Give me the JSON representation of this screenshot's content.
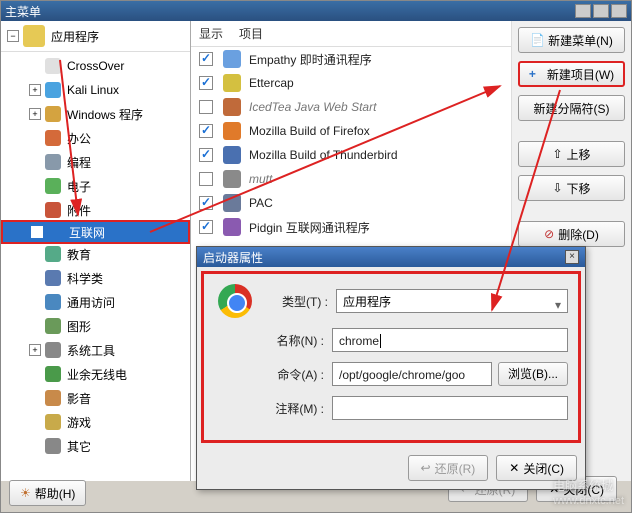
{
  "window": {
    "title": "主菜单"
  },
  "left": {
    "header": "应用程序",
    "items": [
      {
        "label": "CrossOver",
        "color": "#e0e0e0"
      },
      {
        "label": "Kali Linux",
        "color": "#4aa3e0"
      },
      {
        "label": "Windows 程序",
        "color": "#d4a340"
      },
      {
        "label": "办公",
        "color": "#d46a3a"
      },
      {
        "label": "编程",
        "color": "#8899aa"
      },
      {
        "label": "电子",
        "color": "#5ab05a"
      },
      {
        "label": "附件",
        "color": "#c8543a"
      },
      {
        "label": "互联网",
        "color": "#2a72c8",
        "selected": true
      },
      {
        "label": "教育",
        "color": "#55aa88"
      },
      {
        "label": "科学类",
        "color": "#5a7ab0"
      },
      {
        "label": "通用访问",
        "color": "#4a88c0"
      },
      {
        "label": "图形",
        "color": "#6a9a5a"
      },
      {
        "label": "系统工具",
        "color": "#888888"
      },
      {
        "label": "业余无线电",
        "color": "#4a9a4a"
      },
      {
        "label": "影音",
        "color": "#c88a4a"
      },
      {
        "label": "游戏",
        "color": "#c8aa4a"
      },
      {
        "label": "其它",
        "color": "#888888"
      }
    ]
  },
  "mid": {
    "col_show": "显示",
    "col_item": "项目",
    "items": [
      {
        "label": "Empathy 即时通讯程序",
        "checked": true,
        "color": "#6aa0e0"
      },
      {
        "label": "Ettercap",
        "checked": true,
        "color": "#d4c040"
      },
      {
        "label": "IcedTea Java Web Start",
        "checked": false,
        "color": "#c06a3a",
        "italic": true
      },
      {
        "label": "Mozilla Build of Firefox",
        "checked": true,
        "color": "#e07a2a"
      },
      {
        "label": "Mozilla Build of Thunderbird",
        "checked": true,
        "color": "#4a70b0"
      },
      {
        "label": "mutt",
        "checked": false,
        "color": "#8a8a8a",
        "italic": true
      },
      {
        "label": "PAC",
        "checked": true,
        "color": "#6a7a9a"
      },
      {
        "label": "Pidgin 互联网通讯程序",
        "checked": true,
        "color": "#8a5ab0"
      }
    ]
  },
  "sidebtns": {
    "new_menu": "新建菜单(N)",
    "new_item": "新建项目(W)",
    "new_sep": "新建分隔符(S)",
    "move_up": "上移",
    "move_down": "下移",
    "delete": "删除(D)"
  },
  "help": "帮助(H)",
  "dialog": {
    "title": "启动器属性",
    "type_label": "类型(T) :",
    "type_value": "应用程序",
    "name_label": "名称(N) :",
    "name_value": "chrome",
    "cmd_label": "命令(A) :",
    "cmd_value": "/opt/google/chrome/goo",
    "browse": "浏览(B)...",
    "comment_label": "注释(M) :",
    "comment_value": "",
    "revert": "还原(R)",
    "close": "关闭(C)"
  },
  "bottom_buttons": {
    "revert": "还原(R)",
    "close": "关闭(C)"
  },
  "watermark": {
    "main": "电脑系统城",
    "sub": "www.dnxtc.net"
  }
}
